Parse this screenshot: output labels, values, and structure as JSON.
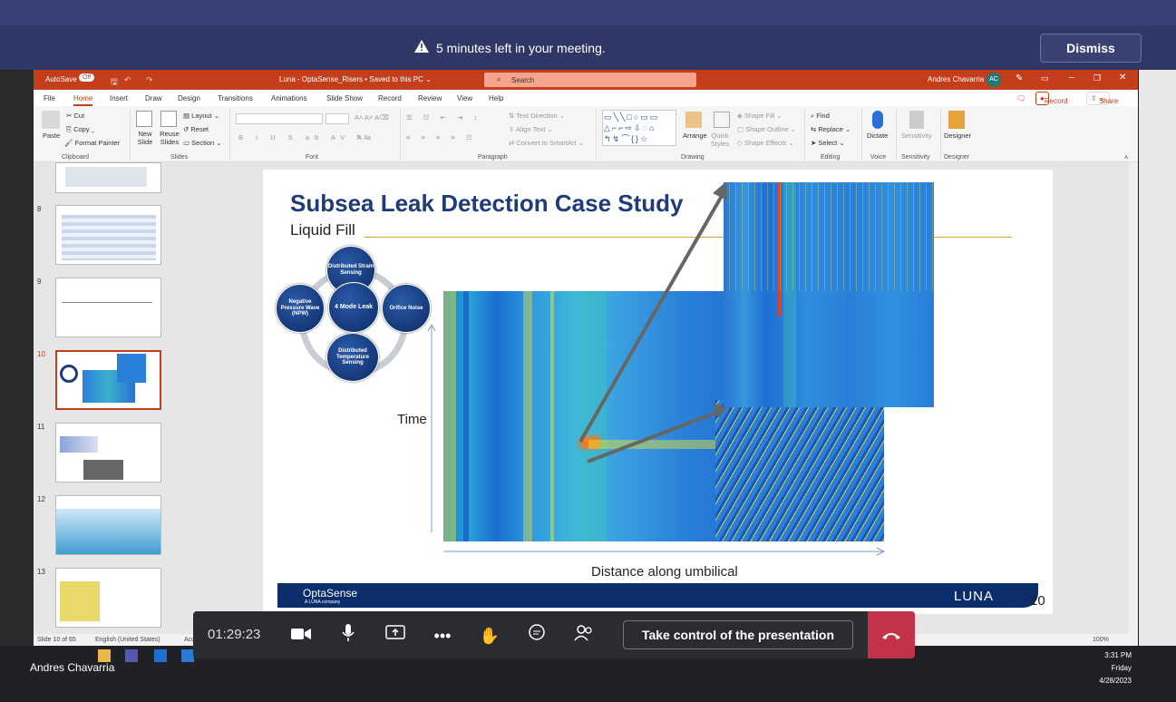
{
  "banner": {
    "message": "5 minutes left in your meeting.",
    "dismiss": "Dismiss"
  },
  "powerpoint": {
    "autosave": "AutoSave",
    "autosave_state": "Off",
    "doc_title": "Luna - OptaSense_Risers  •  Saved to this PC ⌄",
    "search_placeholder": "Search",
    "user_name": "Andres Chavarria",
    "user_initials": "AC",
    "menu": [
      "File",
      "Home",
      "Insert",
      "Draw",
      "Design",
      "Transitions",
      "Animations",
      "Slide Show",
      "Record",
      "Review",
      "View",
      "Help"
    ],
    "record_btn": "Record",
    "share_btn": "Share",
    "ribbon": {
      "clipboard": {
        "paste": "Paste",
        "cut": "Cut",
        "copy": "Copy",
        "format_painter": "Format Painter",
        "label": "Clipboard"
      },
      "slides": {
        "new_slide": "New Slide",
        "reuse": "Reuse Slides",
        "layout": "Layout",
        "reset": "Reset",
        "section": "Section",
        "label": "Slides"
      },
      "font_label": "Font",
      "paragraph": {
        "text_direction": "Text Direction",
        "align_text": "Align Text",
        "convert": "Convert to SmartArt",
        "label": "Paragraph"
      },
      "drawing": {
        "arrange": "Arrange",
        "quick_styles": "Quick Styles",
        "shape_fill": "Shape Fill",
        "shape_outline": "Shape Outline",
        "shape_effects": "Shape Effects",
        "label": "Drawing"
      },
      "editing": {
        "find": "Find",
        "replace": "Replace",
        "select": "Select",
        "label": "Editing"
      },
      "voice": {
        "dictate": "Dictate",
        "label": "Voice"
      },
      "sensitivity": {
        "btn": "Sensitivity",
        "label": "Sensitivity"
      },
      "designer": {
        "btn": "Designer",
        "label": "Designer"
      }
    },
    "thumbnails": [
      {
        "num": "8"
      },
      {
        "num": "9"
      },
      {
        "num": "10"
      },
      {
        "num": "11"
      },
      {
        "num": "12"
      },
      {
        "num": "13"
      }
    ],
    "status": {
      "slide": "Slide 10 of 65",
      "language": "English (United States)",
      "access": "Acc",
      "zoom": "100%"
    }
  },
  "slide": {
    "title": "Subsea Leak Detection Case Study",
    "subtitle": "Liquid Fill",
    "modes": {
      "center": "4 Mode Leak",
      "top": "Distributed Strain Sensing",
      "right": "Orifice Noise",
      "bottom": "Distributed Temperature Sensing",
      "left": "Negative Pressure Wave (NPW)"
    },
    "y_label": "Time",
    "x_label": "Distance along umbilical",
    "footer_brand": "OptaSense",
    "footer_sub": "A LUNA company",
    "footer_logo": "LUNA",
    "page_number": "10"
  },
  "meeting": {
    "timer": "01:29:23",
    "take_control": "Take control of the presentation",
    "participant": "Andres Chavarria"
  },
  "taskbar": {
    "time": "3:31 PM",
    "day": "Friday",
    "date": "4/28/2023"
  }
}
